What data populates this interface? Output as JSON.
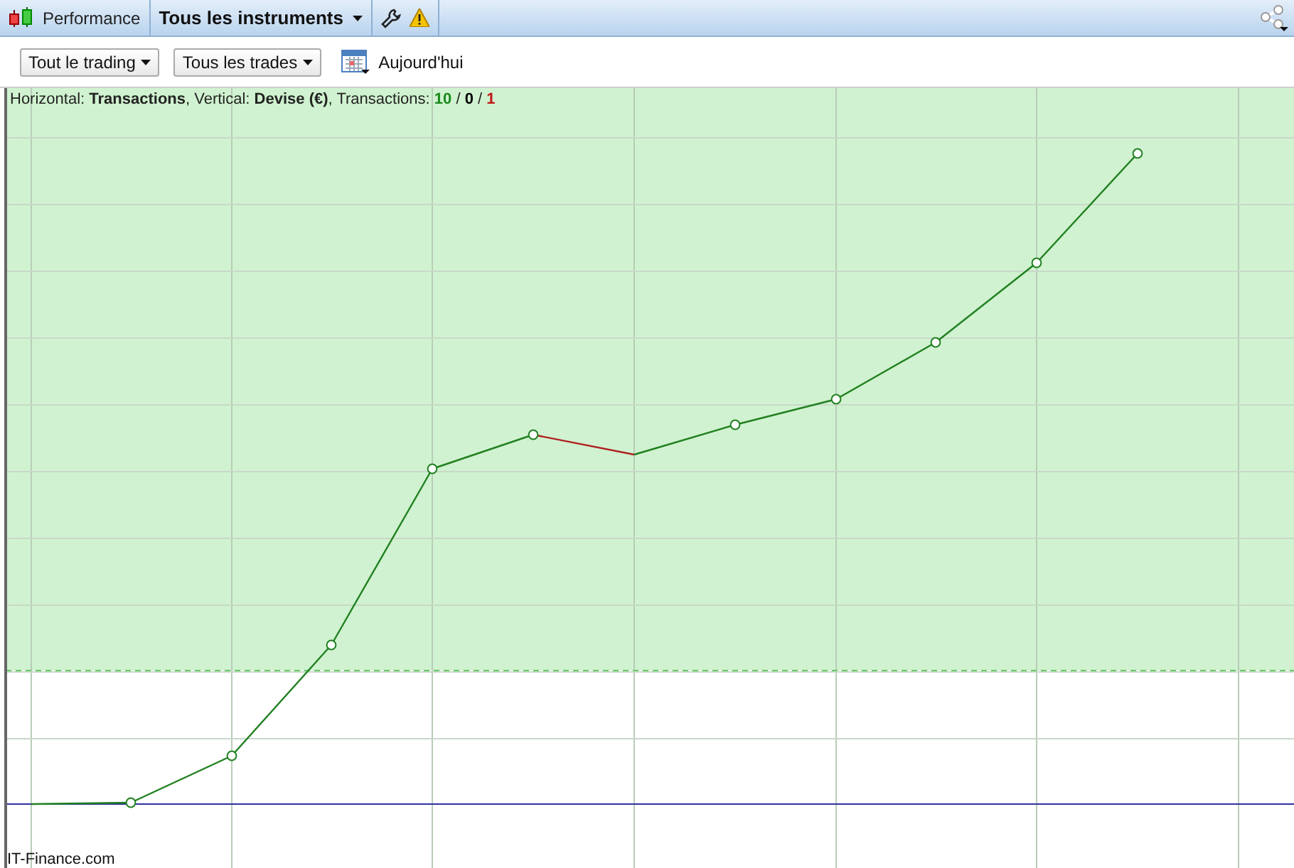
{
  "toolbar": {
    "title": "Performance",
    "instrument_menu": "Tous les instruments"
  },
  "filters": [
    {
      "label": "Tout le trading"
    },
    {
      "label": "Tous les trades"
    }
  ],
  "date_button": "Aujourd'hui",
  "chart_caption": {
    "text": "Horizontal: **Transactions**, Vertical: **Devise (€)**, Transactions:",
    "separator": "/",
    "counts": [
      {
        "value": "10",
        "color": "#1a8a1a"
      },
      {
        "value": "0",
        "color": "#000000"
      },
      {
        "value": "1",
        "color": "#c01818"
      }
    ]
  },
  "footer": "IT-Finance.com"
}
